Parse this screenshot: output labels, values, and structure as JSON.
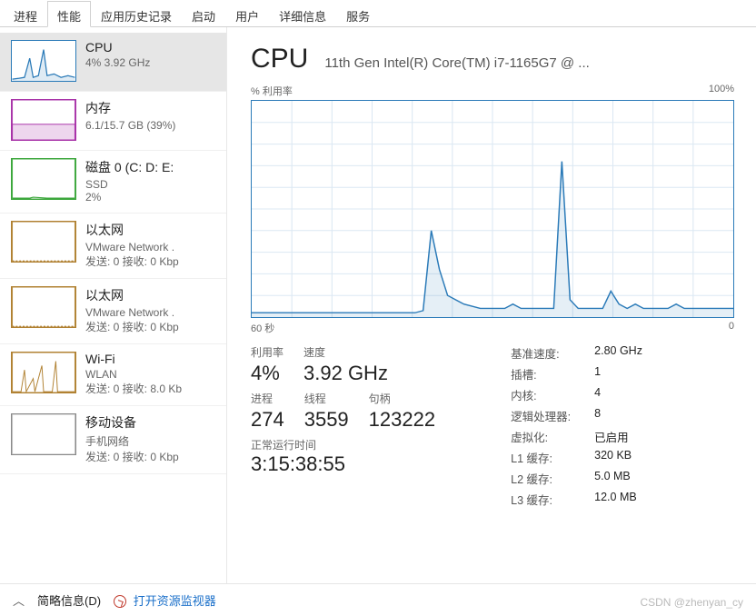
{
  "tabs": [
    "进程",
    "性能",
    "应用历史记录",
    "启动",
    "用户",
    "详细信息",
    "服务"
  ],
  "activeTab": 1,
  "sidebar": [
    {
      "title": "CPU",
      "sub": "4% 3.92 GHz",
      "color": "#2a7ab8",
      "kind": "cpu"
    },
    {
      "title": "内存",
      "sub": "6.1/15.7 GB (39%)",
      "color": "#a832a8",
      "kind": "mem"
    },
    {
      "title": "磁盘 0 (C: D: E:",
      "sub": "SSD",
      "sub2": "2%",
      "color": "#3aa63a",
      "kind": "disk"
    },
    {
      "title": "以太网",
      "sub": "VMware Network .",
      "sub2": "发送: 0 接收: 0 Kbp",
      "color": "#b08030",
      "kind": "net"
    },
    {
      "title": "以太网",
      "sub": "VMware Network .",
      "sub2": "发送: 0 接收: 0 Kbp",
      "color": "#b08030",
      "kind": "net"
    },
    {
      "title": "Wi-Fi",
      "sub": "WLAN",
      "sub2": "发送: 0 接收: 8.0 Kb",
      "color": "#b08030",
      "kind": "wifi"
    },
    {
      "title": "移动设备",
      "sub": "手机网络",
      "sub2": "发送: 0 接收: 0 Kbp",
      "color": "#888",
      "kind": "mobile"
    }
  ],
  "header": {
    "title": "CPU",
    "sub": "11th Gen Intel(R) Core(TM) i7-1165G7 @ ..."
  },
  "chartTop": {
    "left": "% 利用率",
    "right": "100%"
  },
  "chartBottom": {
    "left": "60 秒",
    "right": "0"
  },
  "stats": {
    "util_lbl": "利用率",
    "util_val": "4%",
    "speed_lbl": "速度",
    "speed_val": "3.92 GHz",
    "proc_lbl": "进程",
    "proc_val": "274",
    "thread_lbl": "线程",
    "thread_val": "3559",
    "handle_lbl": "句柄",
    "handle_val": "123222",
    "uptime_lbl": "正常运行时间",
    "uptime_val": "3:15:38:55"
  },
  "specs": [
    {
      "k": "基准速度:",
      "v": "2.80 GHz"
    },
    {
      "k": "插槽:",
      "v": "1"
    },
    {
      "k": "内核:",
      "v": "4"
    },
    {
      "k": "逻辑处理器:",
      "v": "8"
    },
    {
      "k": "虚拟化:",
      "v": "已启用"
    },
    {
      "k": "L1 缓存:",
      "v": "320 KB"
    },
    {
      "k": "L2 缓存:",
      "v": "5.0 MB"
    },
    {
      "k": "L3 缓存:",
      "v": "12.0 MB"
    }
  ],
  "footer": {
    "brief": "简略信息(D)",
    "resmon": "打开资源监视器"
  },
  "watermark": "CSDN @zhenyan_cy",
  "chart_data": {
    "type": "line",
    "title": "% 利用率",
    "xlabel": "60 秒 → 0",
    "ylabel": "% 利用率",
    "ylim": [
      0,
      100
    ],
    "xlim": [
      60,
      0
    ],
    "series": [
      {
        "name": "CPU",
        "values": [
          2,
          2,
          2,
          2,
          2,
          2,
          2,
          2,
          2,
          2,
          2,
          2,
          2,
          2,
          2,
          2,
          2,
          2,
          2,
          2,
          2,
          3,
          40,
          22,
          10,
          8,
          6,
          5,
          4,
          4,
          4,
          4,
          6,
          4,
          4,
          4,
          4,
          4,
          72,
          8,
          4,
          4,
          4,
          4,
          12,
          6,
          4,
          6,
          4,
          4,
          4,
          4,
          6,
          4,
          4,
          4,
          4,
          4,
          4,
          4
        ]
      }
    ]
  }
}
